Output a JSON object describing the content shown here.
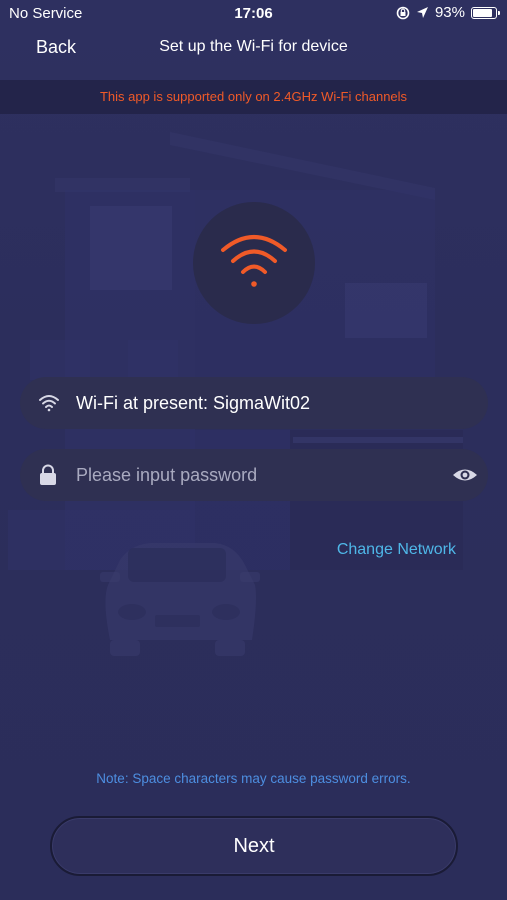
{
  "status_bar": {
    "carrier": "No Service",
    "time": "17:06",
    "battery": "93%",
    "battery_level": 0.93
  },
  "nav": {
    "back_label": "Back",
    "title": "Set up the Wi-Fi for device"
  },
  "notice": "This app is supported only on 2.4GHz Wi-Fi channels",
  "wifi_field": {
    "text": "Wi-Fi at present: SigmaWit02",
    "icon": "wifi-icon"
  },
  "password_field": {
    "value": "",
    "placeholder": "Please input password",
    "icon": "lock-icon",
    "toggle_icon": "eye-icon"
  },
  "change_network_label": "Change Network",
  "note": "Note: Space characters may cause password errors.",
  "next_label": "Next",
  "colors": {
    "accent_orange": "#f05a28",
    "link_blue": "#4fb7e8",
    "note_blue": "#4d8ee0",
    "background": "#2b2d5a"
  }
}
